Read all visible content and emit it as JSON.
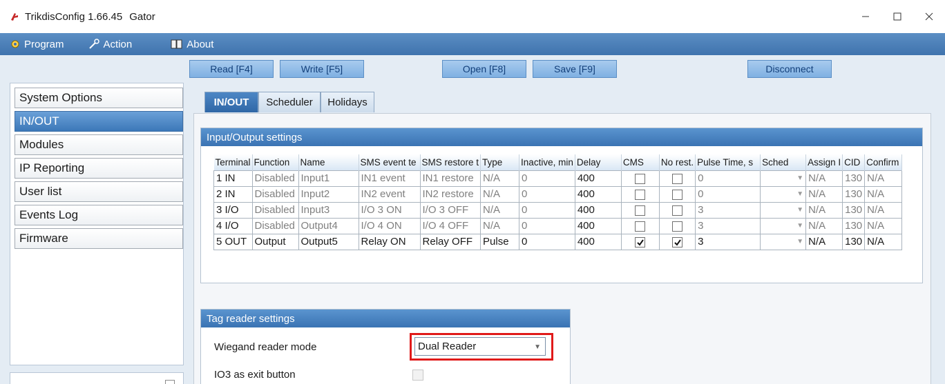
{
  "window": {
    "app_title": "TrikdisConfig 1.66.45",
    "device_name": "Gator",
    "controls": [
      "minimize-icon",
      "maximize-icon",
      "close-icon"
    ]
  },
  "menu": {
    "program": "Program",
    "action": "Action",
    "about": "About"
  },
  "toolbar": {
    "read": "Read [F4]",
    "write": "Write [F5]",
    "open": "Open [F8]",
    "save": "Save [F9]",
    "disconnect": "Disconnect"
  },
  "sidebar": {
    "items": [
      {
        "label": "System Options",
        "active": false
      },
      {
        "label": "IN/OUT",
        "active": true
      },
      {
        "label": "Modules",
        "active": false
      },
      {
        "label": "IP Reporting",
        "active": false
      },
      {
        "label": "User list",
        "active": false
      },
      {
        "label": "Events Log",
        "active": false
      },
      {
        "label": "Firmware",
        "active": false
      }
    ]
  },
  "tabs": [
    {
      "label": "IN/OUT",
      "active": true
    },
    {
      "label": "Scheduler",
      "active": false
    },
    {
      "label": "Holidays",
      "active": false
    }
  ],
  "io_settings": {
    "title": "Input/Output settings",
    "columns": [
      "Terminal",
      "Function",
      "Name",
      "SMS event te",
      "SMS restore t",
      "Type",
      "Inactive, min",
      "Delay",
      "CMS",
      "No rest.",
      "Pulse Time, s",
      "Sched",
      "Assign I",
      "CID",
      "Confirm"
    ],
    "rows": [
      {
        "terminal": "1 IN",
        "function": "Disabled",
        "name": "Input1",
        "sms_event": "IN1 event",
        "sms_restore": "IN1 restore",
        "type": "N/A",
        "inactive": "0",
        "delay": "400",
        "cms": false,
        "no_rest": false,
        "pulse": "0",
        "sched": "",
        "assign": "N/A",
        "cid": "130",
        "confirm": "N/A",
        "disabled": true
      },
      {
        "terminal": "2 IN",
        "function": "Disabled",
        "name": "Input2",
        "sms_event": "IN2 event",
        "sms_restore": "IN2 restore",
        "type": "N/A",
        "inactive": "0",
        "delay": "400",
        "cms": false,
        "no_rest": false,
        "pulse": "0",
        "sched": "",
        "assign": "N/A",
        "cid": "130",
        "confirm": "N/A",
        "disabled": true
      },
      {
        "terminal": "3 I/O",
        "function": "Disabled",
        "name": "Input3",
        "sms_event": "I/O 3 ON",
        "sms_restore": "I/O 3 OFF",
        "type": "N/A",
        "inactive": "0",
        "delay": "400",
        "cms": false,
        "no_rest": false,
        "pulse": "3",
        "sched": "",
        "assign": "N/A",
        "cid": "130",
        "confirm": "N/A",
        "disabled": true
      },
      {
        "terminal": "4 I/O",
        "function": "Disabled",
        "name": "Output4",
        "sms_event": "I/O 4 ON",
        "sms_restore": "I/O 4 OFF",
        "type": "N/A",
        "inactive": "0",
        "delay": "400",
        "cms": false,
        "no_rest": false,
        "pulse": "3",
        "sched": "",
        "assign": "N/A",
        "cid": "130",
        "confirm": "N/A",
        "disabled": true
      },
      {
        "terminal": "5 OUT",
        "function": "Output",
        "name": "Output5",
        "sms_event": "Relay ON",
        "sms_restore": "Relay OFF",
        "type": "Pulse",
        "inactive": "0",
        "delay": "400",
        "cms": true,
        "no_rest": true,
        "pulse": "3",
        "sched": "",
        "assign": "N/A",
        "cid": "130",
        "confirm": "N/A",
        "disabled": false
      }
    ]
  },
  "tag_reader": {
    "title": "Tag reader settings",
    "wiegand_label": "Wiegand reader mode",
    "wiegand_value": "Dual Reader",
    "exit_label": "IO3 as exit button",
    "exit_checked": false
  },
  "colors": {
    "accent": "#3a73b3",
    "highlight": "#e01a1a"
  }
}
